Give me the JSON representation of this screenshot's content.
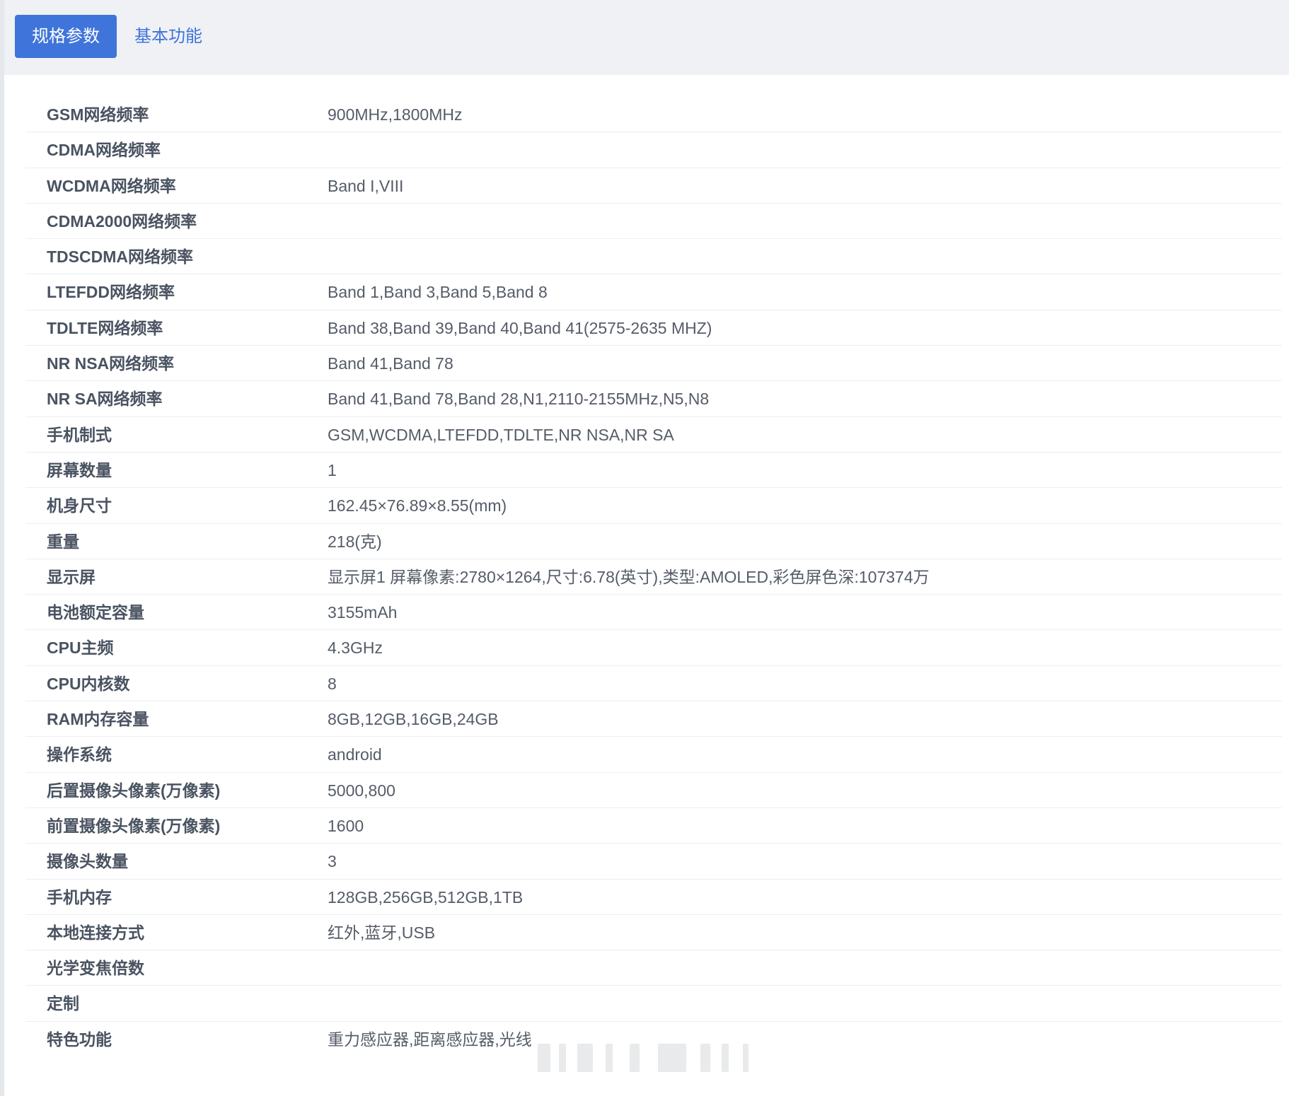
{
  "tabs": [
    {
      "label": "规格参数",
      "active": true
    },
    {
      "label": "基本功能",
      "active": false
    }
  ],
  "specs": [
    {
      "label": "GSM网络频率",
      "value": "900MHz,1800MHz"
    },
    {
      "label": "CDMA网络频率",
      "value": ""
    },
    {
      "label": "WCDMA网络频率",
      "value": "Band I,VIII"
    },
    {
      "label": "CDMA2000网络频率",
      "value": ""
    },
    {
      "label": "TDSCDMA网络频率",
      "value": ""
    },
    {
      "label": "LTEFDD网络频率",
      "value": "Band 1,Band 3,Band 5,Band 8"
    },
    {
      "label": "TDLTE网络频率",
      "value": "Band 38,Band 39,Band 40,Band 41(2575-2635 MHZ)"
    },
    {
      "label": "NR NSA网络频率",
      "value": "Band 41,Band 78"
    },
    {
      "label": "NR SA网络频率",
      "value": "Band 41,Band 78,Band 28,N1,2110-2155MHz,N5,N8"
    },
    {
      "label": "手机制式",
      "value": "GSM,WCDMA,LTEFDD,TDLTE,NR NSA,NR SA"
    },
    {
      "label": "屏幕数量",
      "value": "1"
    },
    {
      "label": "机身尺寸",
      "value": "162.45×76.89×8.55(mm)"
    },
    {
      "label": "重量",
      "value": "218(克)"
    },
    {
      "label": "显示屏",
      "value": "显示屏1 屏幕像素:2780×1264,尺寸:6.78(英寸),类型:AMOLED,彩色屏色深:107374万"
    },
    {
      "label": "电池额定容量",
      "value": "3155mAh"
    },
    {
      "label": "CPU主频",
      "value": "4.3GHz"
    },
    {
      "label": "CPU内核数",
      "value": "8"
    },
    {
      "label": "RAM内存容量",
      "value": "8GB,12GB,16GB,24GB"
    },
    {
      "label": "操作系统",
      "value": "android"
    },
    {
      "label": "后置摄像头像素(万像素)",
      "value": "5000,800"
    },
    {
      "label": "前置摄像头像素(万像素)",
      "value": "1600"
    },
    {
      "label": "摄像头数量",
      "value": "3"
    },
    {
      "label": "手机内存",
      "value": "128GB,256GB,512GB,1TB"
    },
    {
      "label": "本地连接方式",
      "value": "红外,蓝牙,USB"
    },
    {
      "label": "光学变焦倍数",
      "value": ""
    },
    {
      "label": "定制",
      "value": ""
    },
    {
      "label": "特色功能",
      "value": "重力感应器,距离感应器,光线"
    }
  ]
}
